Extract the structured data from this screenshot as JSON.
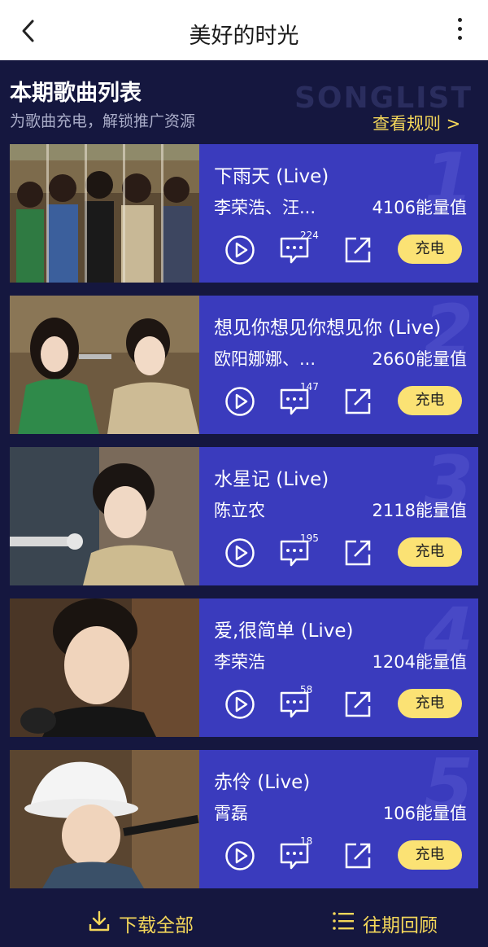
{
  "header": {
    "title": "美好的时光",
    "back_icon": "chevron-left-icon",
    "more_icon": "more-vertical-icon"
  },
  "section": {
    "title": "本期歌曲列表",
    "watermark": "SONGLIST",
    "subtitle": "为歌曲充电，解锁推广资源",
    "rules_link": "查看规则 >"
  },
  "songs": [
    {
      "rank": "1",
      "title": "下雨天 (Live)",
      "artist": "李荣浩、汪...",
      "energy": "4106能量值",
      "comments": "224",
      "charge": "充电"
    },
    {
      "rank": "2",
      "title": "想见你想见你想见你 (Live)",
      "artist": "欧阳娜娜、...",
      "energy": "2660能量值",
      "comments": "147",
      "charge": "充电"
    },
    {
      "rank": "3",
      "title": "水星记 (Live)",
      "artist": "陈立农",
      "energy": "2118能量值",
      "comments": "195",
      "charge": "充电"
    },
    {
      "rank": "4",
      "title": "爱,很简单 (Live)",
      "artist": "李荣浩",
      "energy": "1204能量值",
      "comments": "58",
      "charge": "充电"
    },
    {
      "rank": "5",
      "title": "赤伶 (Live)",
      "artist": "霄磊",
      "energy": "106能量值",
      "comments": "18",
      "charge": "充电"
    }
  ],
  "footer": {
    "download_all": "下载全部",
    "history": "往期回顾"
  },
  "colors": {
    "background": "#15173f",
    "card": "#3a3bbd",
    "accent_yellow": "#fbe274",
    "link_yellow": "#f4d75a"
  }
}
